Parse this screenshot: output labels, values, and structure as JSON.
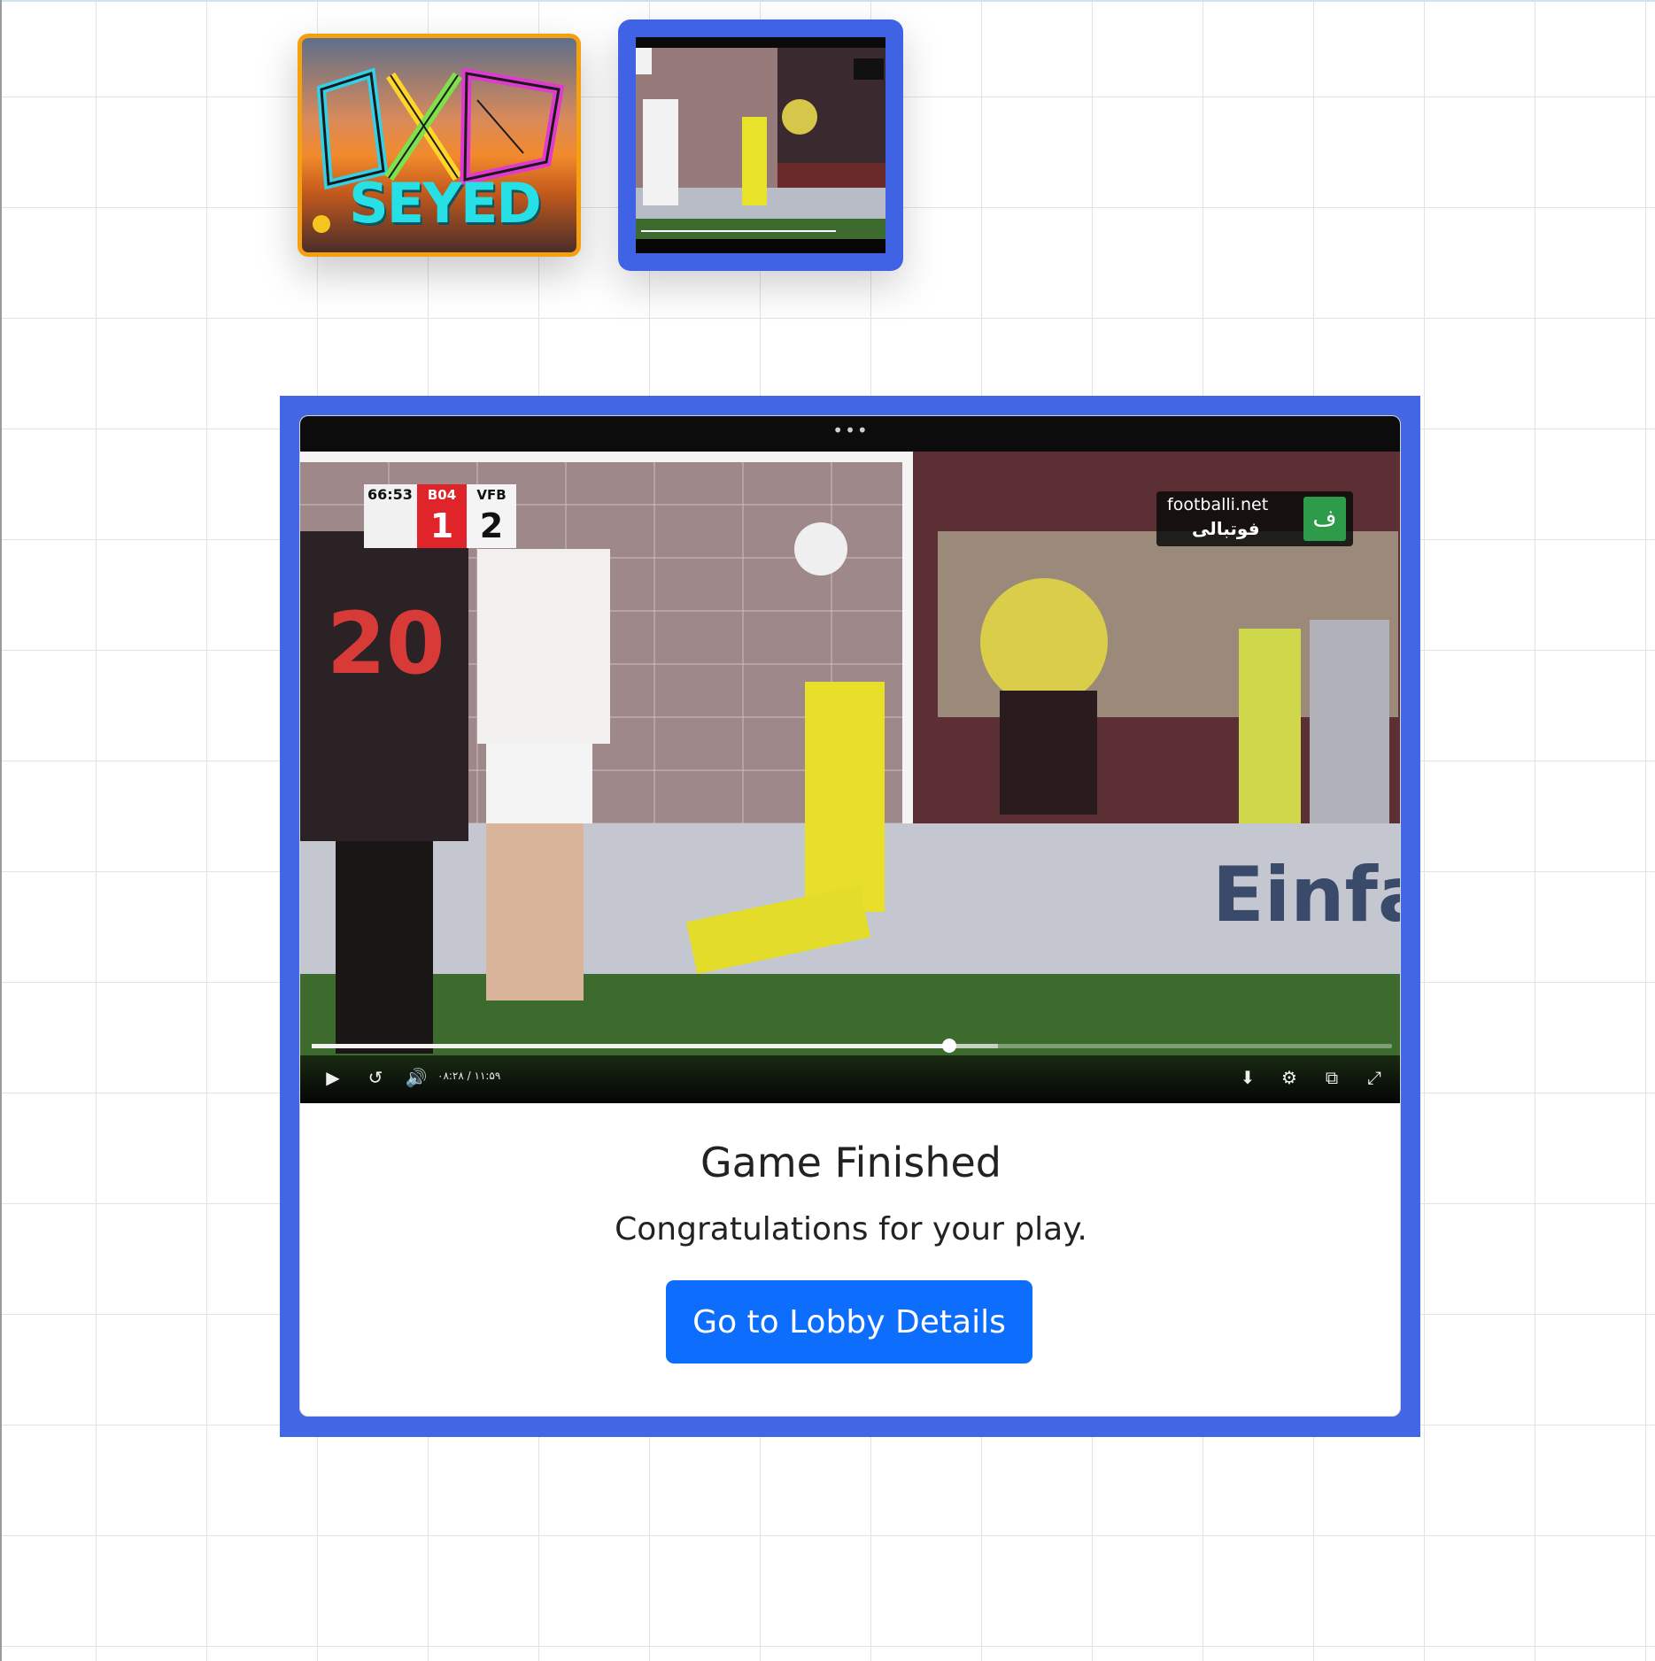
{
  "avatar": {
    "name_text": "SEYED",
    "logo_text": "OXD"
  },
  "video_thumbnail": {
    "label": "video-preview"
  },
  "video": {
    "menu_dots": "•••",
    "scoreboard": {
      "time": "66:53",
      "home_abbr": "B04",
      "home_score": "1",
      "away_abbr": "VFB",
      "away_score": "2"
    },
    "watermark": {
      "site": "footballi.net",
      "persian": "فوتبالی",
      "logo_glyph": "ف"
    },
    "progress_fraction": 0.59,
    "buffered_fraction": 0.635,
    "timecode": "۰۸:۲۸ / ۱۱:۵۹",
    "controls": {
      "play_icon": "▶",
      "rewind_icon": "↺",
      "volume_icon": "🔊",
      "download_icon": "⬇",
      "settings_icon": "⚙",
      "pip_icon": "⧉",
      "fullscreen_icon": "⤢"
    }
  },
  "card": {
    "title": "Game Finished",
    "subtitle": "Congratulations for your play.",
    "button_label": "Go to Lobby Details"
  },
  "colors": {
    "frame_blue": "#4167e4",
    "button_blue": "#0d6efd",
    "avatar_border": "#f5a00f",
    "seyed_text": "#27e0e6"
  }
}
